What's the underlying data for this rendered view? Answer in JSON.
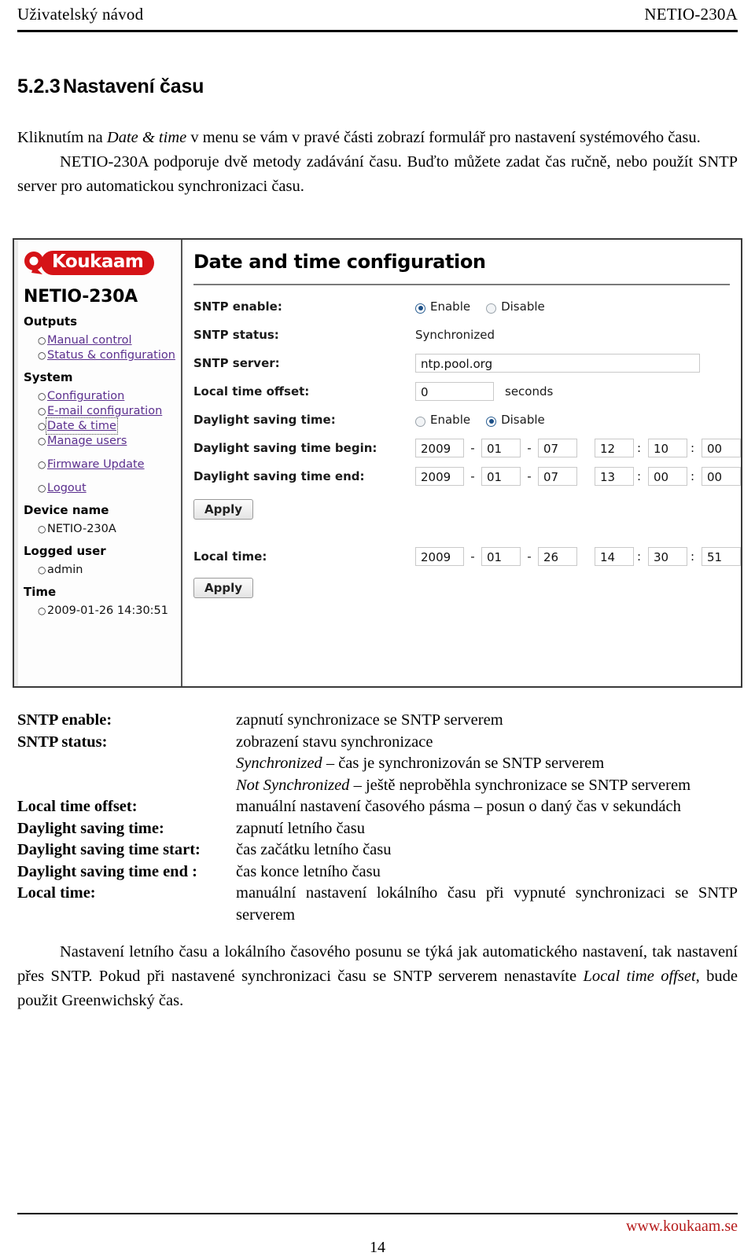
{
  "header": {
    "left": "Uživatelský návod",
    "right": "NETIO-230A"
  },
  "section": {
    "number": "5.2.3",
    "title": "Nastavení času"
  },
  "intro": {
    "p1_a": "Kliknutím na ",
    "p1_italic": "Date & time",
    "p1_b": " v menu se vám v pravé části zobrazí formulář pro nastavení systémového času.",
    "p2": "NETIO-230A podporuje dvě metody zadávání času. Buďto můžete zadat čas ručně, nebo použít SNTP server pro automatickou synchronizaci času."
  },
  "screenshot": {
    "sidebar": {
      "logo_text": "Koukaam",
      "device_title": "NETIO-230A",
      "groups": [
        {
          "heading": "Outputs",
          "items": [
            {
              "label": "Manual control",
              "type": "link"
            },
            {
              "label": "Status & configuration",
              "type": "link"
            }
          ]
        },
        {
          "heading": "System",
          "items": [
            {
              "label": "Configuration",
              "type": "link"
            },
            {
              "label": "E-mail configuration",
              "type": "link"
            },
            {
              "label": "Date & time",
              "type": "link"
            },
            {
              "label": "Manage users",
              "type": "link"
            },
            {
              "label": "Firmware Update",
              "type": "link"
            },
            {
              "label": "Logout",
              "type": "link"
            }
          ]
        },
        {
          "heading": "Device name",
          "items": [
            {
              "label": "NETIO-230A",
              "type": "text"
            }
          ]
        },
        {
          "heading": "Logged user",
          "items": [
            {
              "label": "admin",
              "type": "text"
            }
          ]
        },
        {
          "heading": "Time",
          "items": [
            {
              "label": "2009-01-26 14:30:51",
              "type": "text"
            }
          ]
        }
      ]
    },
    "form": {
      "title": "Date and time configuration",
      "sntp_enable_label": "SNTP enable:",
      "enable_option": "Enable",
      "disable_option": "Disable",
      "sntp_status_label": "SNTP status:",
      "sntp_status_value": "Synchronized",
      "sntp_server_label": "SNTP server:",
      "sntp_server_value": "ntp.pool.org",
      "local_offset_label": "Local time offset:",
      "local_offset_value": "0",
      "local_offset_unit": "seconds",
      "dst_label": "Daylight saving time:",
      "dst_begin_label": "Daylight saving time begin:",
      "dst_end_label": "Daylight saving time end:",
      "local_time_label": "Local time:",
      "apply_label": "Apply",
      "dst_begin": {
        "year": "2009",
        "month": "01",
        "day": "07",
        "hour": "12",
        "minute": "10",
        "second": "00"
      },
      "dst_end": {
        "year": "2009",
        "month": "01",
        "day": "07",
        "hour": "13",
        "minute": "00",
        "second": "00"
      },
      "local_time": {
        "year": "2009",
        "month": "01",
        "day": "26",
        "hour": "14",
        "minute": "30",
        "second": "51"
      },
      "date_sep": "-",
      "time_sep": ":"
    }
  },
  "definitions": [
    {
      "term": "SNTP enable:",
      "desc": "zapnutí synchronizace se SNTP serverem"
    },
    {
      "term": "SNTP status:",
      "desc": "zobrazení stavu synchronizace"
    },
    {
      "term": "",
      "desc_italic": "Synchronized",
      "desc": " – čas je synchronizován se SNTP serverem"
    },
    {
      "term": "",
      "desc_italic": "Not Synchronized",
      "desc": " – ještě neproběhla synchronizace se SNTP serverem"
    },
    {
      "term": "Local time offset:",
      "desc": "manuální nastavení časového pásma – posun o daný čas v sekundách"
    },
    {
      "term": "Daylight saving time:",
      "desc": "zapnutí letního času"
    },
    {
      "term": "Daylight saving time start:",
      "desc": "čas začátku letního času"
    },
    {
      "term": "Daylight saving time end :",
      "desc": "čas konce letního času"
    },
    {
      "term": "Local time:",
      "desc": "manuální nastavení lokálního času při vypnuté synchronizaci se SNTP serverem"
    }
  ],
  "closing": {
    "a": "Nastavení letního času a lokálního časového posunu se týká jak automatického nastavení, tak nastavení přes SNTP. Pokud při nastavené synchronizaci času se SNTP serverem nenastavíte ",
    "italic": "Local time offset",
    "b": ", bude použit Greenwichský čas."
  },
  "footer": {
    "url": "www.koukaam.se",
    "page_number": "14"
  }
}
